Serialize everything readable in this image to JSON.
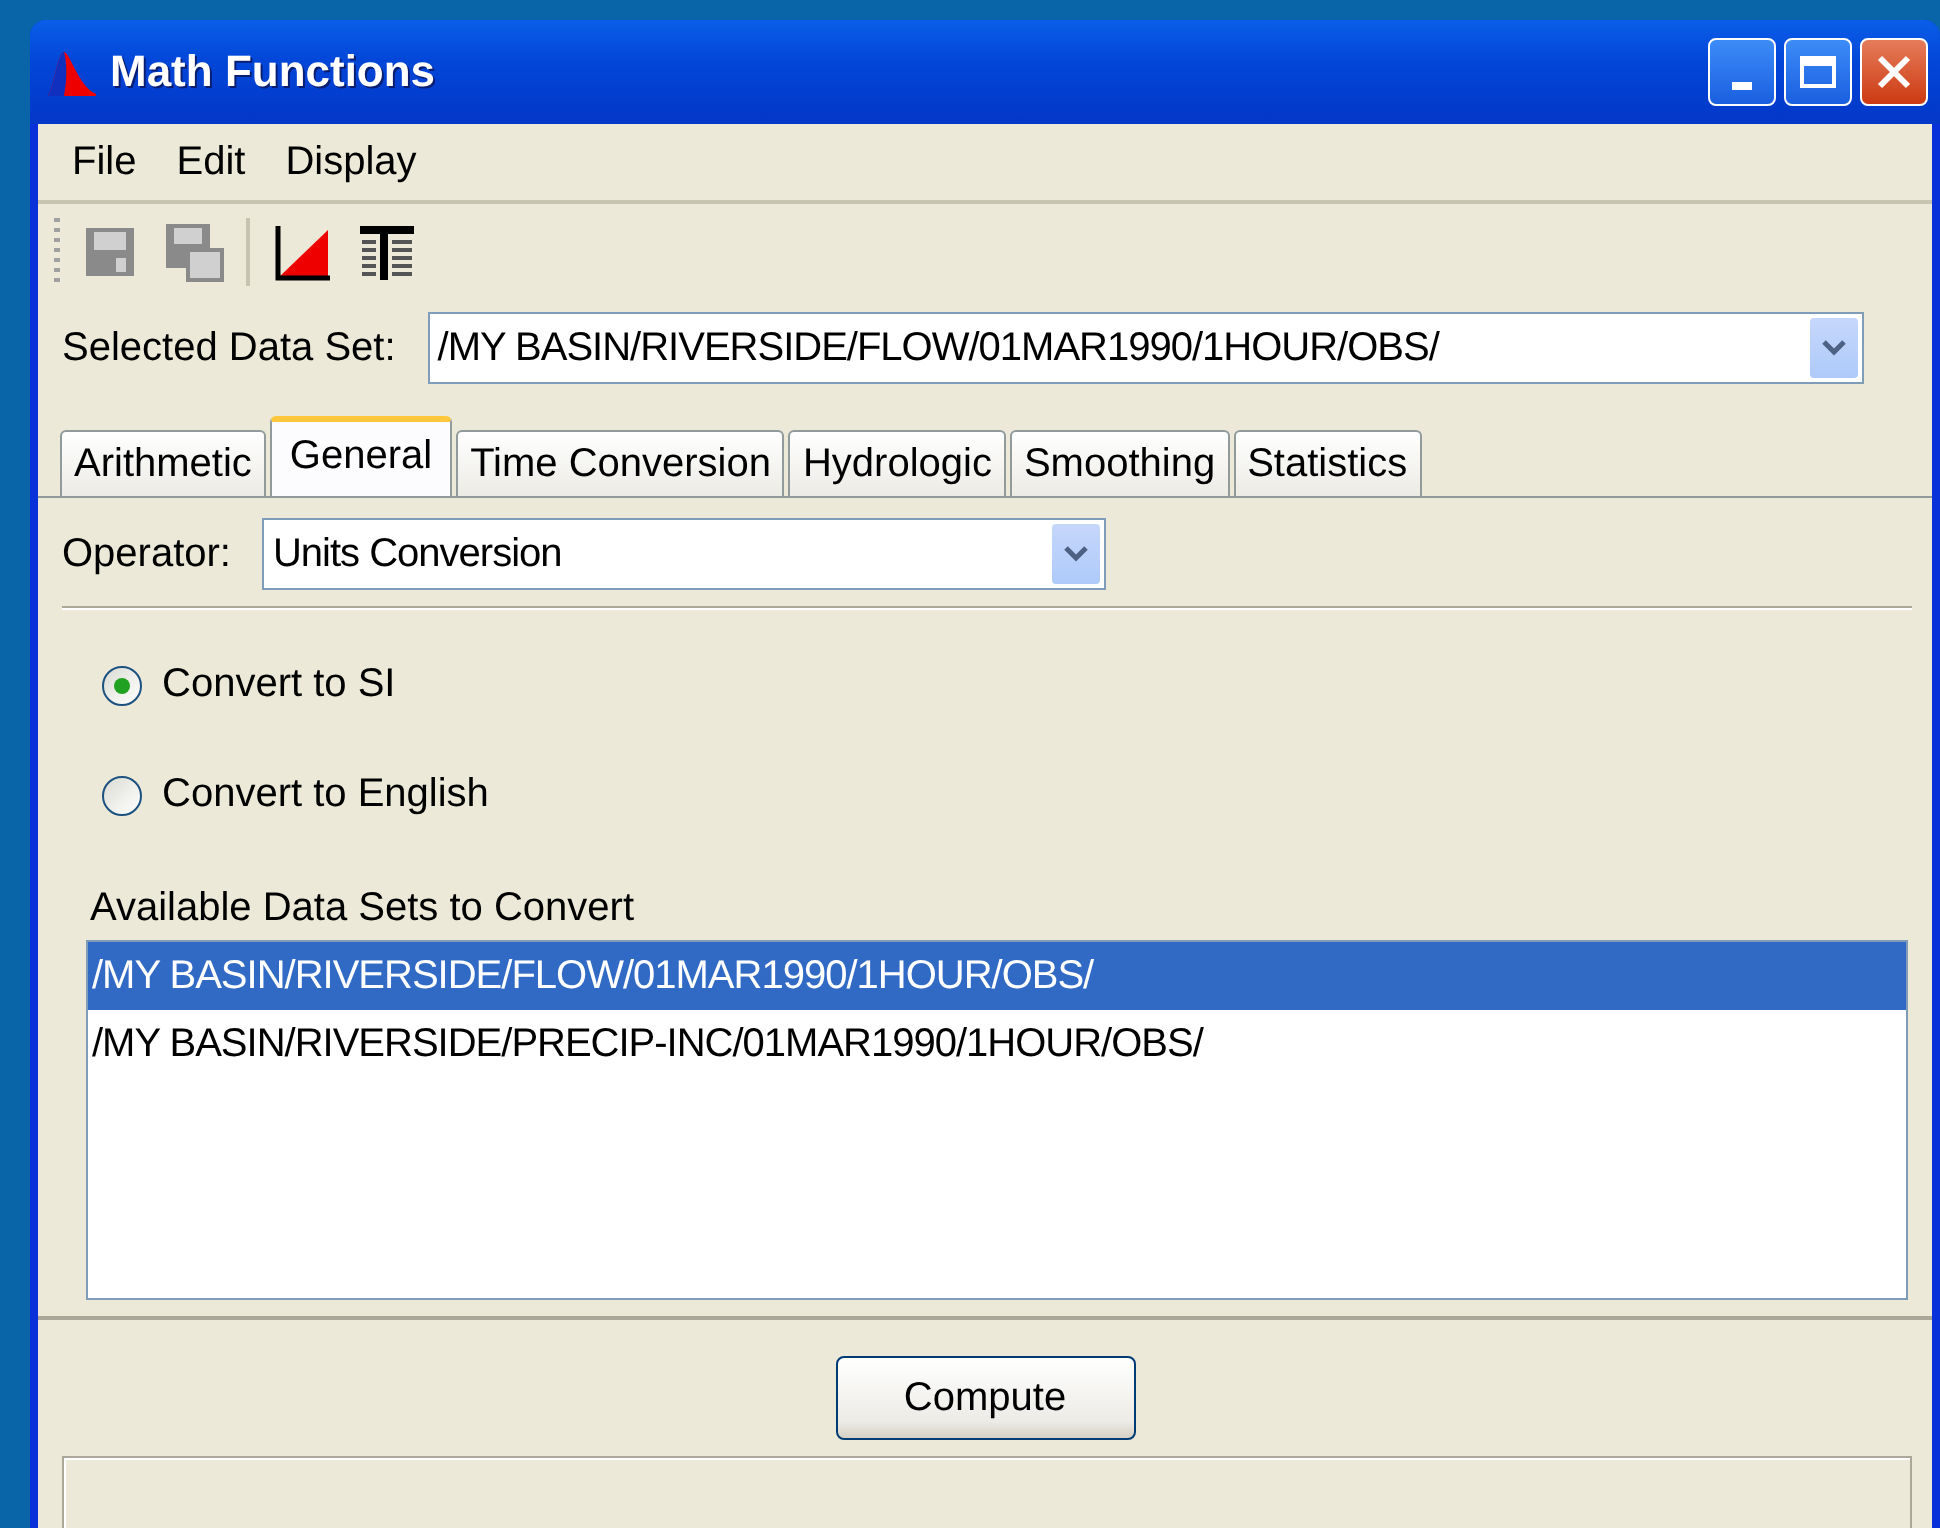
{
  "window": {
    "title": "Math Functions"
  },
  "menu": [
    {
      "label": "File"
    },
    {
      "label": "Edit"
    },
    {
      "label": "Display"
    }
  ],
  "toolbar": [
    {
      "kind": "save",
      "disabled": true
    },
    {
      "kind": "save-as",
      "disabled": true
    },
    {
      "kind": "separator"
    },
    {
      "kind": "plot",
      "disabled": false
    },
    {
      "kind": "table",
      "disabled": false
    }
  ],
  "selected_data_set": {
    "label": "Selected Data Set:",
    "value": "/MY BASIN/RIVERSIDE/FLOW/01MAR1990/1HOUR/OBS/"
  },
  "tabs": [
    {
      "label": "Arithmetic",
      "selected": false
    },
    {
      "label": "General",
      "selected": true
    },
    {
      "label": "Time Conversion",
      "selected": false
    },
    {
      "label": "Hydrologic",
      "selected": false
    },
    {
      "label": "Smoothing",
      "selected": false
    },
    {
      "label": "Statistics",
      "selected": false
    }
  ],
  "operator": {
    "label": "Operator:",
    "value": "Units Conversion"
  },
  "radios": [
    {
      "label": "Convert to SI",
      "selected": true
    },
    {
      "label": "Convert to English",
      "selected": false
    }
  ],
  "data_sets": {
    "label": "Available Data Sets to Convert",
    "items": [
      {
        "label": "/MY BASIN/RIVERSIDE/FLOW/01MAR1990/1HOUR/OBS/",
        "selected": true
      },
      {
        "label": "/MY BASIN/RIVERSIDE/PRECIP-INC/01MAR1990/1HOUR/OBS/",
        "selected": false
      }
    ]
  },
  "compute_button": {
    "label": "Compute"
  }
}
